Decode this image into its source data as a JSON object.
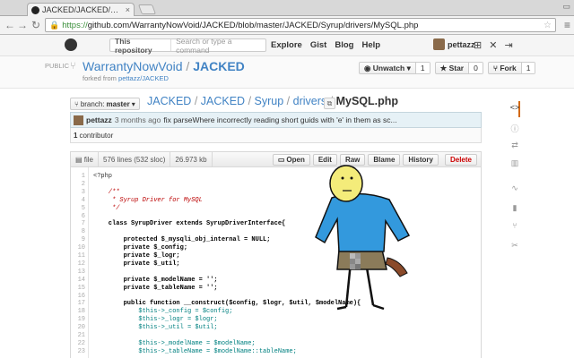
{
  "browser": {
    "tab_title": "JACKED/JACKED/Syrup/dri",
    "tab_close": "×",
    "url_scheme": "https://",
    "url_rest": "github.com/WarrantyNowVoid/JACKED/blob/master/JACKED/Syrup/drivers/MySQL.php",
    "icons": [
      "back-arrow-icon",
      "forward-arrow-icon",
      "reload-icon",
      "star-icon",
      "menu-icon"
    ]
  },
  "github": {
    "scope_label": "This repository",
    "search_placeholder": "Search or type a command",
    "nav": [
      "Explore",
      "Gist",
      "Blog",
      "Help"
    ],
    "username": "pettazz"
  },
  "repo": {
    "visibility": "PUBLIC",
    "owner": "WarrantyNowVoid",
    "separator": "/",
    "name": "JACKED",
    "forked_prefix": "forked from",
    "forked_from": "pettazz/JACKED",
    "unwatch_label": "Unwatch",
    "unwatch_count": "1",
    "star_label": "Star",
    "star_count": "0",
    "fork_label": "Fork",
    "fork_count": "1"
  },
  "file_nav": {
    "branch_prefix": "branch:",
    "branch_name": "master",
    "crumbs": [
      "JACKED",
      "JACKED",
      "Syrup",
      "drivers"
    ],
    "file": "MySQL.php"
  },
  "commit": {
    "author": "pettazz",
    "time": "3 months ago",
    "message": "fix parseWhere incorrectly reading short guids with 'e' in them as sc...",
    "contributors_count": "1",
    "contributors_label": "contributor"
  },
  "file_header": {
    "type": "file",
    "lines": "576 lines (532 sloc)",
    "size": "26.973 kb",
    "buttons": {
      "open": "Open",
      "edit": "Edit",
      "raw": "Raw",
      "blame": "Blame",
      "history": "History",
      "delete": "Delete"
    }
  },
  "code_lines": [
    {
      "n": "1",
      "t": "<?php",
      "c": ""
    },
    {
      "n": "2",
      "t": "",
      "c": ""
    },
    {
      "n": "3",
      "t": "    /**",
      "c": "cm"
    },
    {
      "n": "4",
      "t": "     * Syrup Driver for MySQL",
      "c": "cm"
    },
    {
      "n": "5",
      "t": "     */",
      "c": "cm"
    },
    {
      "n": "6",
      "t": "",
      "c": ""
    },
    {
      "n": "7",
      "t": "    class SyrupDriver extends SyrupDriverInterface{",
      "c": "kw"
    },
    {
      "n": "8",
      "t": "",
      "c": ""
    },
    {
      "n": "9",
      "t": "        protected $_mysqli_obj_internal = NULL;",
      "c": "kw"
    },
    {
      "n": "10",
      "t": "        private $_config;",
      "c": "kw"
    },
    {
      "n": "11",
      "t": "        private $_logr;",
      "c": "kw"
    },
    {
      "n": "12",
      "t": "        private $_util;",
      "c": "kw"
    },
    {
      "n": "13",
      "t": "",
      "c": ""
    },
    {
      "n": "14",
      "t": "        private $_modelName = '';",
      "c": "kw"
    },
    {
      "n": "15",
      "t": "        private $_tableName = '';",
      "c": "kw"
    },
    {
      "n": "16",
      "t": "",
      "c": ""
    },
    {
      "n": "17",
      "t": "        public function __construct($config, $logr, $util, $modelName){",
      "c": "kw"
    },
    {
      "n": "18",
      "t": "            $this->_config = $config;",
      "c": "vr"
    },
    {
      "n": "19",
      "t": "            $this->_logr = $logr;",
      "c": "vr"
    },
    {
      "n": "20",
      "t": "            $this->_util = $util;",
      "c": "vr"
    },
    {
      "n": "21",
      "t": "",
      "c": ""
    },
    {
      "n": "22",
      "t": "            $this->_modelName = $modelName;",
      "c": "vr"
    },
    {
      "n": "23",
      "t": "            $this->_tableName = $modelName::tableName;",
      "c": "vr"
    }
  ],
  "sidebar_icons": [
    "code-icon",
    "issues-icon",
    "pull-requests-icon",
    "wiki-icon",
    "pulse-icon",
    "graphs-icon",
    "network-icon",
    "settings-icon"
  ],
  "colors": {
    "link": "#4183c4",
    "accent": "#d26911",
    "delete": "#cc0000",
    "cartoon_shirt": "#3399dd",
    "cartoon_face": "#f4ec7a"
  }
}
